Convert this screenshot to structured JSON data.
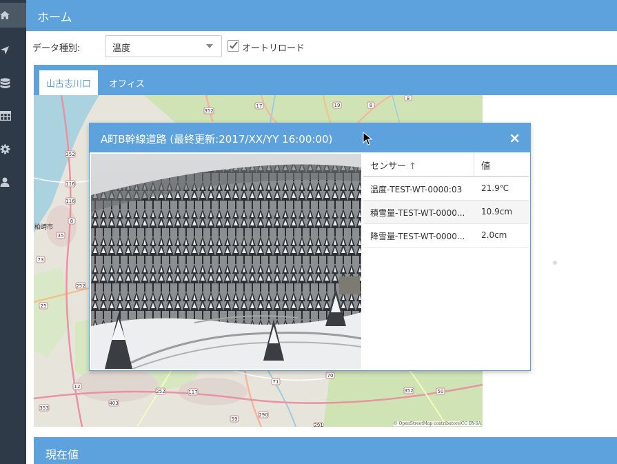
{
  "header": {
    "title": "ホーム"
  },
  "sidebar": {
    "items": [
      {
        "icon": "home-icon"
      },
      {
        "icon": "location-arrow-icon"
      },
      {
        "icon": "database-icon"
      },
      {
        "icon": "table-icon"
      },
      {
        "icon": "gear-icon"
      },
      {
        "icon": "user-icon"
      }
    ]
  },
  "controls": {
    "data_type_label": "データ種別:",
    "data_type_value": "温度",
    "autoreload_label": "オートリロード",
    "autoreload_checked": true
  },
  "tabs": [
    {
      "label": "山古志川口",
      "active": true
    },
    {
      "label": "オフィス",
      "active": false
    }
  ],
  "map": {
    "attribution": "© OpenStreetMap contributors/CC BY-SA",
    "place_label": "柏崎市",
    "route_labels": [
      "352",
      "17",
      "19",
      "8",
      "8",
      "352",
      "116",
      "116",
      "8",
      "35",
      "73",
      "252",
      "25",
      "12",
      "403",
      "252",
      "117",
      "71",
      "70",
      "352",
      "50",
      "353",
      "59",
      "290",
      "291"
    ]
  },
  "popup": {
    "title": "A町B幹線道路 (最終更新:2017/XX/YY 16:00:00)",
    "close_symbol": "×",
    "table": {
      "headers": [
        "センサー",
        "値"
      ],
      "rows": [
        [
          "温度-TEST-WT-0000:03",
          "21.9℃"
        ],
        [
          "積雪量-TEST-WT-0000...",
          "10.9cm"
        ],
        [
          "降雪量-TEST-WT-0000...",
          "2.0cm"
        ]
      ]
    }
  },
  "section": {
    "title": "現在値"
  },
  "colors": {
    "accent": "#5ea2dd",
    "sidebar": "#2e3a47"
  }
}
